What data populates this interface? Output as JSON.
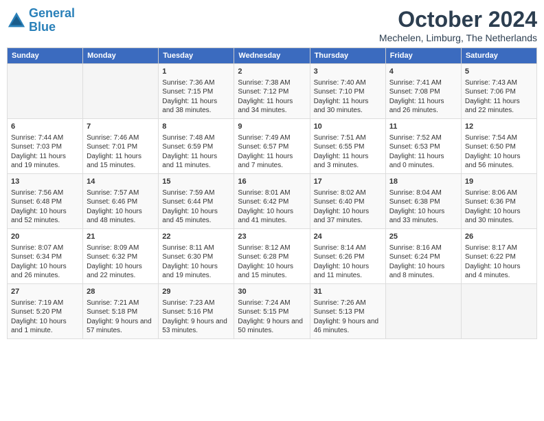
{
  "header": {
    "logo_line1": "General",
    "logo_line2": "Blue",
    "month_title": "October 2024",
    "location": "Mechelen, Limburg, The Netherlands"
  },
  "weekdays": [
    "Sunday",
    "Monday",
    "Tuesday",
    "Wednesday",
    "Thursday",
    "Friday",
    "Saturday"
  ],
  "weeks": [
    [
      {
        "day": "",
        "info": ""
      },
      {
        "day": "",
        "info": ""
      },
      {
        "day": "1",
        "info": "Sunrise: 7:36 AM\nSunset: 7:15 PM\nDaylight: 11 hours and 38 minutes."
      },
      {
        "day": "2",
        "info": "Sunrise: 7:38 AM\nSunset: 7:12 PM\nDaylight: 11 hours and 34 minutes."
      },
      {
        "day": "3",
        "info": "Sunrise: 7:40 AM\nSunset: 7:10 PM\nDaylight: 11 hours and 30 minutes."
      },
      {
        "day": "4",
        "info": "Sunrise: 7:41 AM\nSunset: 7:08 PM\nDaylight: 11 hours and 26 minutes."
      },
      {
        "day": "5",
        "info": "Sunrise: 7:43 AM\nSunset: 7:06 PM\nDaylight: 11 hours and 22 minutes."
      }
    ],
    [
      {
        "day": "6",
        "info": "Sunrise: 7:44 AM\nSunset: 7:03 PM\nDaylight: 11 hours and 19 minutes."
      },
      {
        "day": "7",
        "info": "Sunrise: 7:46 AM\nSunset: 7:01 PM\nDaylight: 11 hours and 15 minutes."
      },
      {
        "day": "8",
        "info": "Sunrise: 7:48 AM\nSunset: 6:59 PM\nDaylight: 11 hours and 11 minutes."
      },
      {
        "day": "9",
        "info": "Sunrise: 7:49 AM\nSunset: 6:57 PM\nDaylight: 11 hours and 7 minutes."
      },
      {
        "day": "10",
        "info": "Sunrise: 7:51 AM\nSunset: 6:55 PM\nDaylight: 11 hours and 3 minutes."
      },
      {
        "day": "11",
        "info": "Sunrise: 7:52 AM\nSunset: 6:53 PM\nDaylight: 11 hours and 0 minutes."
      },
      {
        "day": "12",
        "info": "Sunrise: 7:54 AM\nSunset: 6:50 PM\nDaylight: 10 hours and 56 minutes."
      }
    ],
    [
      {
        "day": "13",
        "info": "Sunrise: 7:56 AM\nSunset: 6:48 PM\nDaylight: 10 hours and 52 minutes."
      },
      {
        "day": "14",
        "info": "Sunrise: 7:57 AM\nSunset: 6:46 PM\nDaylight: 10 hours and 48 minutes."
      },
      {
        "day": "15",
        "info": "Sunrise: 7:59 AM\nSunset: 6:44 PM\nDaylight: 10 hours and 45 minutes."
      },
      {
        "day": "16",
        "info": "Sunrise: 8:01 AM\nSunset: 6:42 PM\nDaylight: 10 hours and 41 minutes."
      },
      {
        "day": "17",
        "info": "Sunrise: 8:02 AM\nSunset: 6:40 PM\nDaylight: 10 hours and 37 minutes."
      },
      {
        "day": "18",
        "info": "Sunrise: 8:04 AM\nSunset: 6:38 PM\nDaylight: 10 hours and 33 minutes."
      },
      {
        "day": "19",
        "info": "Sunrise: 8:06 AM\nSunset: 6:36 PM\nDaylight: 10 hours and 30 minutes."
      }
    ],
    [
      {
        "day": "20",
        "info": "Sunrise: 8:07 AM\nSunset: 6:34 PM\nDaylight: 10 hours and 26 minutes."
      },
      {
        "day": "21",
        "info": "Sunrise: 8:09 AM\nSunset: 6:32 PM\nDaylight: 10 hours and 22 minutes."
      },
      {
        "day": "22",
        "info": "Sunrise: 8:11 AM\nSunset: 6:30 PM\nDaylight: 10 hours and 19 minutes."
      },
      {
        "day": "23",
        "info": "Sunrise: 8:12 AM\nSunset: 6:28 PM\nDaylight: 10 hours and 15 minutes."
      },
      {
        "day": "24",
        "info": "Sunrise: 8:14 AM\nSunset: 6:26 PM\nDaylight: 10 hours and 11 minutes."
      },
      {
        "day": "25",
        "info": "Sunrise: 8:16 AM\nSunset: 6:24 PM\nDaylight: 10 hours and 8 minutes."
      },
      {
        "day": "26",
        "info": "Sunrise: 8:17 AM\nSunset: 6:22 PM\nDaylight: 10 hours and 4 minutes."
      }
    ],
    [
      {
        "day": "27",
        "info": "Sunrise: 7:19 AM\nSunset: 5:20 PM\nDaylight: 10 hours and 1 minute."
      },
      {
        "day": "28",
        "info": "Sunrise: 7:21 AM\nSunset: 5:18 PM\nDaylight: 9 hours and 57 minutes."
      },
      {
        "day": "29",
        "info": "Sunrise: 7:23 AM\nSunset: 5:16 PM\nDaylight: 9 hours and 53 minutes."
      },
      {
        "day": "30",
        "info": "Sunrise: 7:24 AM\nSunset: 5:15 PM\nDaylight: 9 hours and 50 minutes."
      },
      {
        "day": "31",
        "info": "Sunrise: 7:26 AM\nSunset: 5:13 PM\nDaylight: 9 hours and 46 minutes."
      },
      {
        "day": "",
        "info": ""
      },
      {
        "day": "",
        "info": ""
      }
    ]
  ]
}
